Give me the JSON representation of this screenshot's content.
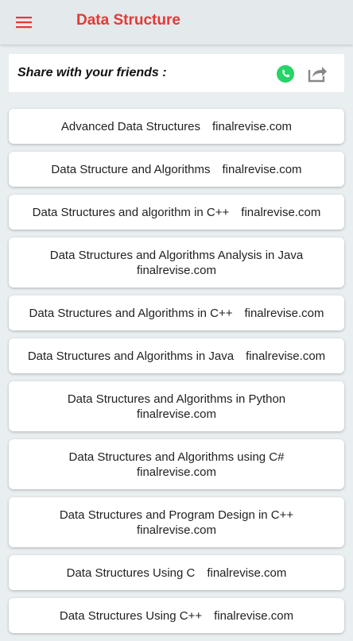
{
  "header": {
    "title": "Data Structure",
    "menu_icon": "hamburger-menu-icon"
  },
  "share": {
    "label": "Share with your friends :",
    "whatsapp_icon": "whatsapp-icon",
    "share_icon": "share-icon",
    "whatsapp_color": "#25d366",
    "share_color": "#888888"
  },
  "items": [
    {
      "text": "Advanced Data Structures finalrevise.com"
    },
    {
      "text": "Data Structure and Algorithms finalrevise.com"
    },
    {
      "text": "Data Structures and algorithm in C++ finalrevise.com"
    },
    {
      "text": "Data Structures and Algorithms Analysis in Java\nfinalrevise.com"
    },
    {
      "text": "Data Structures and Algorithms in C++ finalrevise.com"
    },
    {
      "text": "Data Structures and Algorithms in Java finalrevise.com"
    },
    {
      "text": "Data Structures and Algorithms in Python\nfinalrevise.com"
    },
    {
      "text": "Data Structures and Algorithms using C#\nfinalrevise.com"
    },
    {
      "text": "Data Structures and Program Design in C++\nfinalrevise.com"
    },
    {
      "text": "Data Structures Using C finalrevise.com"
    },
    {
      "text": "Data Structures Using C++ finalrevise.com"
    }
  ],
  "colors": {
    "accent": "#e53935",
    "background": "#e9eef0",
    "card": "#ffffff"
  }
}
